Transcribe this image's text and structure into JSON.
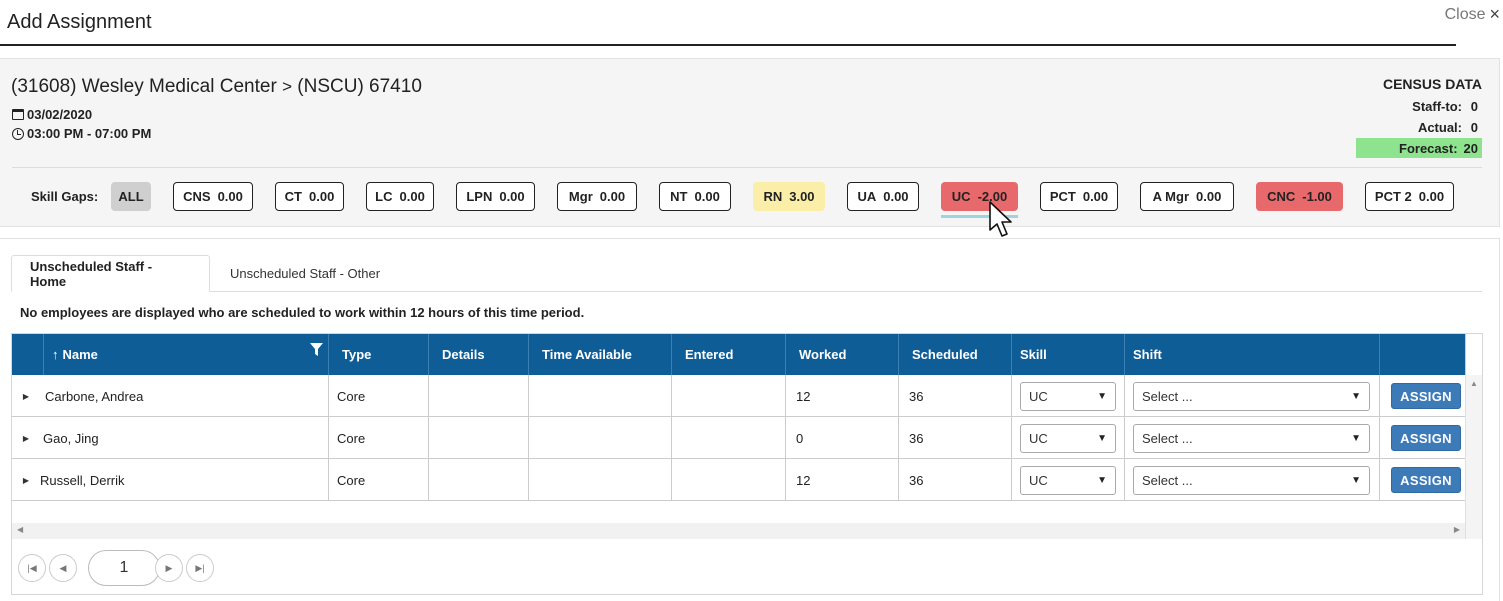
{
  "dialog": {
    "title": "Add Assignment",
    "close_label": "Close",
    "close_icon": "×"
  },
  "facility": {
    "name": "(31608) Wesley Medical Center",
    "separator": ">",
    "unit": "(NSCU) 67410",
    "date": "03/02/2020",
    "time_range": "03:00 PM - 07:00 PM"
  },
  "census": {
    "header": "CENSUS DATA",
    "staff_to_label": "Staff-to:",
    "staff_to_value": "0",
    "actual_label": "Actual:",
    "actual_value": "0",
    "forecast_label": "Forecast:",
    "forecast_value": "20",
    "forecast_color": "#8ee38e"
  },
  "skill_gaps": {
    "label": "Skill Gaps:",
    "chips": [
      {
        "label": "ALL",
        "value": "",
        "state": "all"
      },
      {
        "label": "CNS",
        "value": "0.00",
        "state": "neutral"
      },
      {
        "label": "CT",
        "value": "0.00",
        "state": "neutral"
      },
      {
        "label": "LC",
        "value": "0.00",
        "state": "neutral"
      },
      {
        "label": "LPN",
        "value": "0.00",
        "state": "neutral"
      },
      {
        "label": "Mgr",
        "value": "0.00",
        "state": "neutral"
      },
      {
        "label": "NT",
        "value": "0.00",
        "state": "neutral"
      },
      {
        "label": "RN",
        "value": "3.00",
        "state": "surplus"
      },
      {
        "label": "UA",
        "value": "0.00",
        "state": "neutral"
      },
      {
        "label": "UC",
        "value": "-2.00",
        "state": "deficit"
      },
      {
        "label": "PCT",
        "value": "0.00",
        "state": "neutral"
      },
      {
        "label": "A Mgr",
        "value": "0.00",
        "state": "neutral"
      },
      {
        "label": "CNC",
        "value": "-1.00",
        "state": "deficit"
      },
      {
        "label": "PCT 2",
        "value": "0.00",
        "state": "neutral"
      }
    ],
    "colors": {
      "surplus": "#fbeea8",
      "deficit": "#e8696b",
      "all": "#cfcfcf"
    }
  },
  "tabs": [
    {
      "label": "Unscheduled Staff - Home",
      "active": true
    },
    {
      "label": "Unscheduled Staff - Other",
      "active": false
    }
  ],
  "notice": "No employees are displayed who are scheduled to work within 12 hours of this time period.",
  "grid": {
    "header_color": "#0e5d97",
    "columns": [
      "Name",
      "Type",
      "Details",
      "Time Available",
      "Entered",
      "Worked",
      "Scheduled",
      "Skill",
      "Shift",
      ""
    ],
    "sort_icon": "↑",
    "rows": [
      {
        "name": "Carbone, Andrea",
        "type": "Core",
        "details": "",
        "time_available": "",
        "entered": "",
        "worked": "12",
        "scheduled": "36",
        "skill": "UC",
        "shift": "Select ...",
        "action": "ASSIGN"
      },
      {
        "name": "Gao, Jing",
        "type": "Core",
        "details": "",
        "time_available": "",
        "entered": "",
        "worked": "0",
        "scheduled": "36",
        "skill": "UC",
        "shift": "Select ...",
        "action": "ASSIGN"
      },
      {
        "name": "Russell, Derrik",
        "type": "Core",
        "details": "",
        "time_available": "",
        "entered": "",
        "worked": "12",
        "scheduled": "36",
        "skill": "UC",
        "shift": "Select ...",
        "action": "ASSIGN"
      }
    ]
  },
  "pager": {
    "current_page": "1"
  }
}
